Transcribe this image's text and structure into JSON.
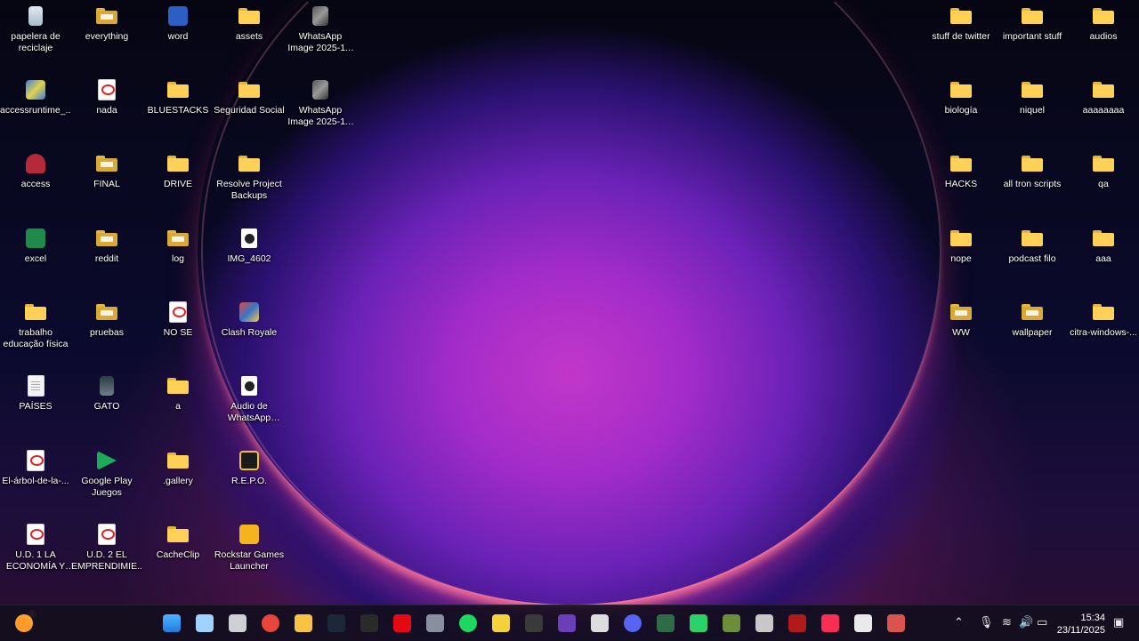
{
  "desktop": {
    "icons": [
      {
        "label": "papelera de reciclaje",
        "type": "recycle"
      },
      {
        "label": "everything",
        "type": "folder-dark"
      },
      {
        "label": "word",
        "type": "word"
      },
      {
        "label": "assets",
        "type": "folder"
      },
      {
        "label": "WhatsApp Image 2025-11-23 at 1...",
        "type": "photo"
      },
      {
        "label": "accessruntime_...",
        "type": "installer"
      },
      {
        "label": "nada",
        "type": "pdf"
      },
      {
        "label": "BLUESTACKS",
        "type": "folder"
      },
      {
        "label": "Seguridad Social",
        "type": "folder"
      },
      {
        "label": "WhatsApp Image 2025-11-23 at 1...",
        "type": "photo"
      },
      {
        "label": "access",
        "type": "access"
      },
      {
        "label": "FINAL",
        "type": "folder-dark"
      },
      {
        "label": "DRIVE",
        "type": "folder"
      },
      {
        "label": "Resolve Project Backups",
        "type": "folder"
      },
      {
        "label": "excel",
        "type": "excel"
      },
      {
        "label": "reddit",
        "type": "folder-dark"
      },
      {
        "label": "log",
        "type": "folder-dark"
      },
      {
        "label": "IMG_4602",
        "type": "media"
      },
      {
        "label": "trabalho educação física",
        "type": "folder"
      },
      {
        "label": "pruebas",
        "type": "folder-dark"
      },
      {
        "label": "NO SE",
        "type": "pdf"
      },
      {
        "label": "Clash Royale",
        "type": "game"
      },
      {
        "label": "PAÍSES",
        "type": "doc"
      },
      {
        "label": "GATO",
        "type": "gato"
      },
      {
        "label": "a",
        "type": "folder"
      },
      {
        "label": "Audio de WhatsApp 2025...",
        "type": "media"
      },
      {
        "label": "El-árbol-de-la-...",
        "type": "pdf"
      },
      {
        "label": "Google Play Juegos",
        "type": "gplay"
      },
      {
        "label": ".gallery",
        "type": "folder"
      },
      {
        "label": "R.E.P.O.",
        "type": "repo"
      },
      {
        "label": "U.D. 1 LA ECONOMÍA Y L...",
        "type": "pdf"
      },
      {
        "label": "U.D. 2 EL EMPRENDIMIE...",
        "type": "pdf"
      },
      {
        "label": "CacheClip",
        "type": "folder"
      },
      {
        "label": "Rockstar Games Launcher",
        "type": "rockstar"
      },
      {
        "label": "stuff de twitter",
        "type": "folder"
      },
      {
        "label": "important stuff",
        "type": "folder"
      },
      {
        "label": "audios",
        "type": "folder"
      },
      {
        "label": "biología",
        "type": "folder"
      },
      {
        "label": "niquel",
        "type": "folder"
      },
      {
        "label": "aaaaaaaa",
        "type": "folder"
      },
      {
        "label": "HACKS",
        "type": "folder"
      },
      {
        "label": "all tron scripts",
        "type": "folder"
      },
      {
        "label": "qa",
        "type": "folder"
      },
      {
        "label": "nope",
        "type": "folder"
      },
      {
        "label": "podcast filo",
        "type": "folder"
      },
      {
        "label": "aaa",
        "type": "folder"
      },
      {
        "label": "WW",
        "type": "folder-dark"
      },
      {
        "label": "wallpaper",
        "type": "folder-dark"
      },
      {
        "label": "citra-windows-...",
        "type": "folder"
      }
    ]
  },
  "taskbar": {
    "notification_badge": "1",
    "apps": [
      "start-icon",
      "search-icon",
      "task-view-icon",
      "chrome-icon",
      "file-explorer-icon",
      "steam-icon",
      "epic-games-icon",
      "netflix-icon",
      "settings-icon",
      "spotify-icon",
      "lemon-app-icon",
      "obs-icon",
      "davinci-icon",
      "logitech-icon",
      "discord-icon",
      "snipping-icon",
      "line-icon",
      "minecraft-icon",
      "usb-icon",
      "app-red-icon",
      "apple-music-icon",
      "chatgpt-icon",
      "git-diamond-icon"
    ],
    "tray": {
      "time": "15:34",
      "date": "23/11/2025"
    }
  },
  "colors": {
    "folder": "#ffd257",
    "taskbar": "#120e1e"
  }
}
